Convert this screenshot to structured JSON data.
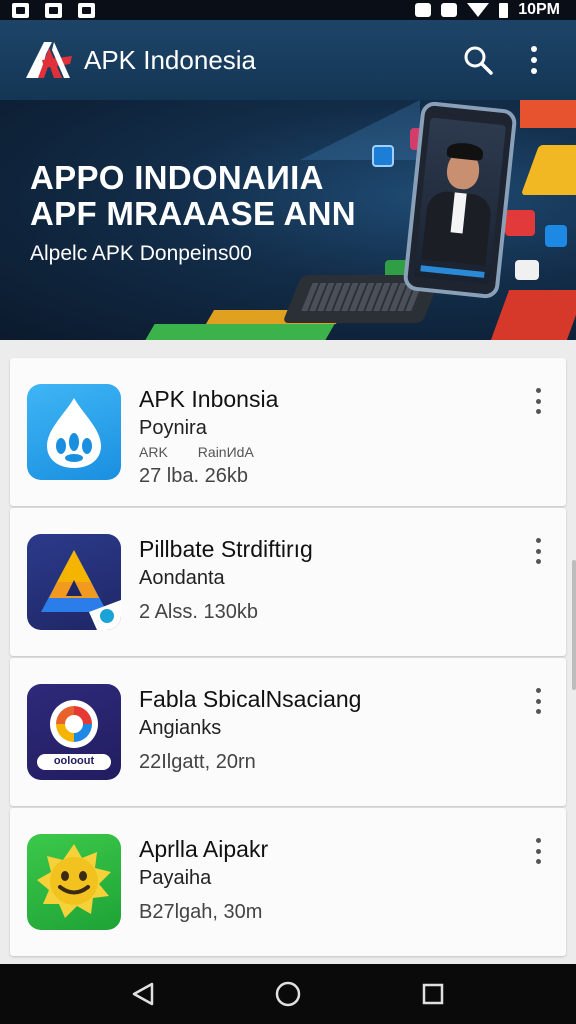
{
  "status_bar": {
    "time": "10PM"
  },
  "app_bar": {
    "title": "APK Indonesia",
    "icons": [
      "search-icon",
      "more-vert-icon"
    ]
  },
  "banner": {
    "headline_1": "APPO INDONAИIA",
    "headline_2": "APF MRAAASE ANN",
    "subtitle": "Alpelc APK Donpeins00"
  },
  "apps": [
    {
      "name": "APK Inbonsia",
      "developer": "Poynira",
      "tag_1": "ARK",
      "tag_2": "RainИdA",
      "size": "27 lba. 26kb",
      "icon": "drop-app-icon"
    },
    {
      "name": "Pillbate Strdiftirıg",
      "developer": "Aondanta",
      "tag_1": "",
      "tag_2": "",
      "size": "2 Alss. 130kb",
      "icon": "triangle-app-icon"
    },
    {
      "name": "Fabla SbicalNsaciang",
      "developer": "Angianks",
      "tag_1": "",
      "tag_2": "",
      "size": "22Ilgatt, 20rn",
      "icon": "circle-app-icon",
      "icon_label": "ooloout"
    },
    {
      "name": "Aprlla Aipakr",
      "developer": "Payaiha",
      "tag_1": "",
      "tag_2": "",
      "size": "B27lgah, 30m",
      "icon": "sun-face-app-icon"
    }
  ],
  "colors": {
    "app_bar": "#1d4468",
    "banner": "#122c48",
    "card": "#fbfbfb",
    "nav_bar": "#0a0a0a"
  },
  "nav": [
    "back-icon",
    "home-icon",
    "recents-icon"
  ]
}
